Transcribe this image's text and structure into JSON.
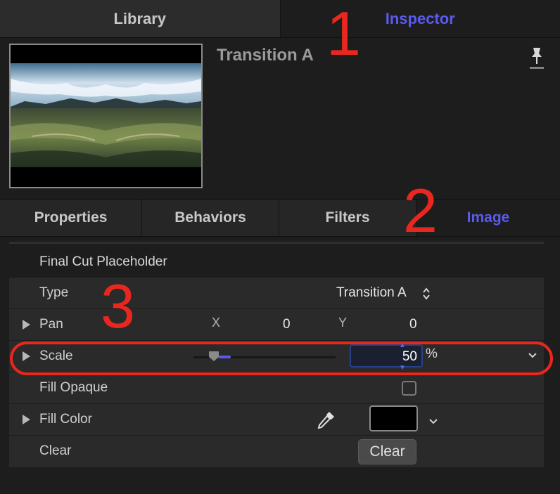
{
  "top_tabs": {
    "library": "Library",
    "inspector": "Inspector"
  },
  "header": {
    "title": "Transition A"
  },
  "sub_tabs": {
    "properties": "Properties",
    "behaviors": "Behaviors",
    "filters": "Filters",
    "image": "Image"
  },
  "section": {
    "title": "Final Cut Placeholder"
  },
  "rows": {
    "type": {
      "label": "Type",
      "value": "Transition A",
      "stepper": "⌃⌄"
    },
    "pan": {
      "label": "Pan",
      "x_label": "X",
      "x_value": "0",
      "y_label": "Y",
      "y_value": "0"
    },
    "scale": {
      "label": "Scale",
      "value": "50",
      "unit": "%",
      "slider_fraction": 0.25
    },
    "fill_opaque": {
      "label": "Fill Opaque",
      "checked": false
    },
    "fill_color": {
      "label": "Fill Color",
      "color": "#000000"
    },
    "clear": {
      "label": "Clear",
      "button": "Clear"
    }
  },
  "annotations": {
    "a1": "1",
    "a2": "2",
    "a3": "3"
  },
  "colors": {
    "accent": "#5a5af0",
    "annotation": "#e8281f",
    "background": "#1d1d1d"
  }
}
